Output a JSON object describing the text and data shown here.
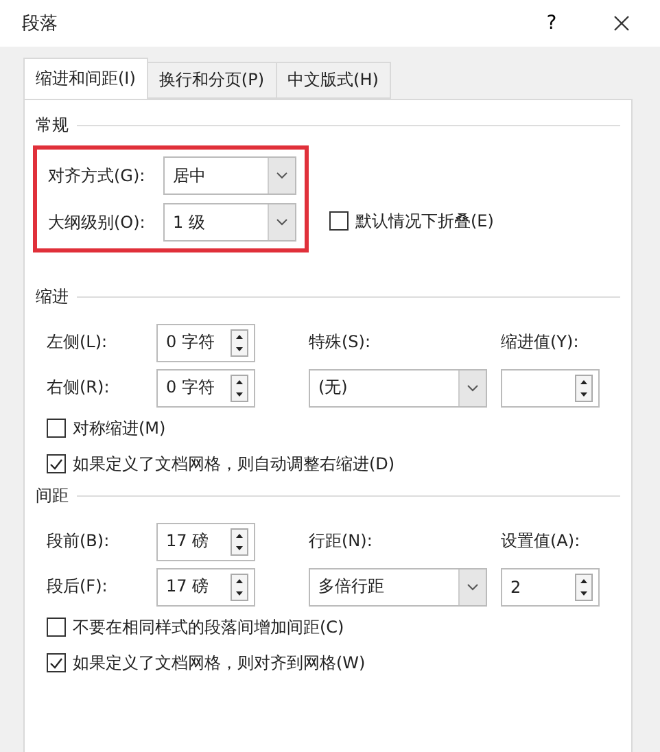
{
  "window": {
    "title": "段落",
    "help": "?"
  },
  "tabs": [
    {
      "label": "缩进和间距(I)",
      "selected": true
    },
    {
      "label": "换行和分页(P)",
      "selected": false
    },
    {
      "label": "中文版式(H)",
      "selected": false
    }
  ],
  "general": {
    "heading": "常规",
    "highlighted": true,
    "alignment": {
      "label": "对齐方式(G):",
      "value": "居中"
    },
    "outline_level": {
      "label": "大纲级别(O):",
      "value": "1 级"
    },
    "collapse": {
      "label": "默认情况下折叠(E)",
      "checked": false
    }
  },
  "indent": {
    "heading": "缩进",
    "left": {
      "label": "左侧(L):",
      "value": "0 字符"
    },
    "right": {
      "label": "右侧(R):",
      "value": "0 字符"
    },
    "special": {
      "label": "特殊(S):",
      "value": "(无)"
    },
    "by": {
      "label": "缩进值(Y):"
    },
    "checks": [
      {
        "label": "对称缩进(M)",
        "checked": false
      },
      {
        "label": "如果定义了文档网格，则自动调整右缩进(D)",
        "checked": true
      }
    ]
  },
  "spacing": {
    "heading": "间距",
    "before": {
      "label": "段前(B):",
      "value": "17 磅"
    },
    "after": {
      "label": "段后(F):",
      "value": "17 磅"
    },
    "line_spacing": {
      "label": "行距(N):",
      "value": "多倍行距"
    },
    "at": {
      "label": "设置值(A):",
      "value": "2"
    },
    "checks": [
      {
        "label": "不要在相同样式的段落间增加间距(C)",
        "checked": false
      },
      {
        "label": "如果定义了文档网格，则对齐到网格(W)",
        "checked": true
      }
    ]
  }
}
